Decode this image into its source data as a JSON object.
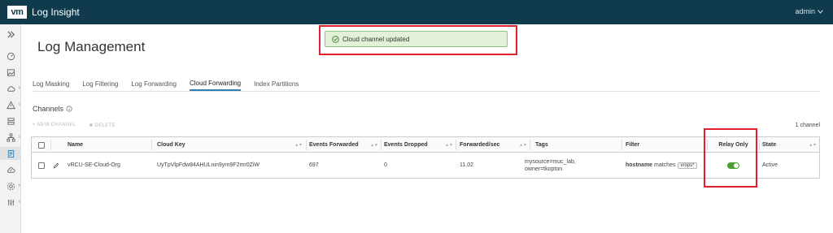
{
  "app": {
    "logo": "vm",
    "title": "Log Insight",
    "user": "admin"
  },
  "nav": {
    "icons": [
      "expand-icon",
      "dashboard-icon",
      "image-icon",
      "cloud-icon",
      "alert-icon",
      "inventory-icon",
      "network-icon",
      "log-management-icon",
      "cloud-sync-icon",
      "settings-icon",
      "config-icon"
    ]
  },
  "page": {
    "title": "Log Management"
  },
  "toast": {
    "message": "Cloud channel updated"
  },
  "tabs": [
    {
      "label": "Log Masking"
    },
    {
      "label": "Log Filtering"
    },
    {
      "label": "Log Forwarding"
    },
    {
      "label": "Cloud Forwarding",
      "active": true
    },
    {
      "label": "Index Partitions"
    }
  ],
  "channels": {
    "title": "Channels",
    "new_label": "+ NEW CHANNEL",
    "delete_label": "✖ DELETE",
    "count_label": "1 channel"
  },
  "table": {
    "columns": [
      "Name",
      "Cloud Key",
      "Events Forwarded",
      "Events Dropped",
      "Forwarded/sec",
      "Tags",
      "Filter",
      "Relay Only",
      "State"
    ],
    "rows": [
      {
        "name": "vRCU-SE-Cloud-Org",
        "cloud_key": "UyTpVlpFdw84AHULnin9yrn9F2mr0ZiW",
        "events_forwarded": "697",
        "events_dropped": "0",
        "forwarded_sec": "11.02",
        "tags_line1": "mysource=muc_lab,",
        "tags_line2": "owner=tkopton",
        "filter_field": "hostname",
        "filter_op": "matches",
        "filter_value": "vrops*",
        "relay_only": true,
        "state": "Active"
      }
    ]
  },
  "colors": {
    "topbar": "#0f3b4d",
    "accent": "#2e7eb8",
    "toggle_on": "#4a9d2e",
    "highlight": "#e0202a",
    "toast_bg": "#e2f1d7"
  }
}
